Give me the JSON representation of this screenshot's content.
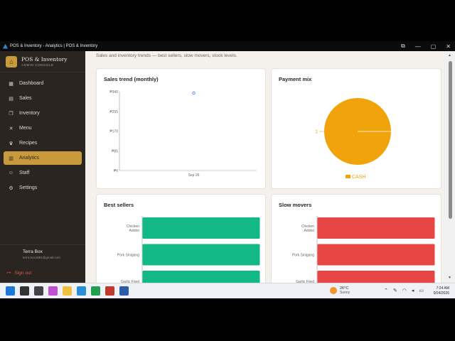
{
  "window": {
    "title": "POS & Inventory - Analytics | POS & Inventory",
    "minimize": "—",
    "maximize": "▢",
    "close": "✕",
    "extra": "⧉"
  },
  "brand": {
    "name": "POS & Inventory",
    "subtitle": "ADMIN CONSOLE"
  },
  "sidebar": {
    "items": [
      {
        "label": "Dashboard",
        "icon": "grid-icon",
        "glyph": "▦"
      },
      {
        "label": "Sales",
        "icon": "receipt-icon",
        "glyph": "▤"
      },
      {
        "label": "Inventory",
        "icon": "boxes-icon",
        "glyph": "❒"
      },
      {
        "label": "Menu",
        "icon": "utensils-icon",
        "glyph": "✕"
      },
      {
        "label": "Recipes",
        "icon": "chef-hat-icon",
        "glyph": "♛"
      },
      {
        "label": "Analytics",
        "icon": "bar-chart-icon",
        "glyph": "▥",
        "active": true
      },
      {
        "label": "Staff",
        "icon": "users-icon",
        "glyph": "☺"
      },
      {
        "label": "Settings",
        "icon": "gear-icon",
        "glyph": "⚙"
      }
    ]
  },
  "user": {
    "name": "Terra Box",
    "email": "terra.box1881@gmail.com"
  },
  "signout": {
    "label": "Sign out",
    "glyph": "↦"
  },
  "main": {
    "subtitle": "Sales and inventory trends — best sellers, slow movers, stock levels."
  },
  "cards": {
    "sales_trend": {
      "title": "Sales trend (monthly)"
    },
    "payment_mix": {
      "title": "Payment mix"
    },
    "best_sellers": {
      "title": "Best sellers"
    },
    "slow_movers": {
      "title": "Slow movers"
    }
  },
  "chart_data": [
    {
      "type": "line",
      "title": "Sales trend (monthly)",
      "x": [
        "Sep 26"
      ],
      "series": [
        {
          "values": [
            340
          ]
        }
      ],
      "yticks": [
        "₱340",
        "₱255",
        "₱170",
        "₱85",
        "₱0"
      ],
      "ylim": [
        0,
        340
      ],
      "color": "#3b7dd8"
    },
    {
      "type": "pie",
      "title": "Payment mix",
      "slices": [
        {
          "label": "CASH",
          "value": 1
        }
      ],
      "data_label": "1",
      "color": "#f0a30a"
    },
    {
      "type": "bar",
      "title": "Best sellers",
      "orientation": "horizontal",
      "categories": [
        [
          "Chicken",
          "Adobo"
        ],
        [
          "Pork Sinigang"
        ],
        [
          "Garlic Fried"
        ]
      ],
      "values": [
        1,
        1,
        1
      ],
      "color": "#12b886"
    },
    {
      "type": "bar",
      "title": "Slow movers",
      "orientation": "horizontal",
      "categories": [
        [
          "Chicken",
          "Adobo"
        ],
        [
          "Pork Sinigang"
        ],
        [
          "Garlic Fried"
        ]
      ],
      "values": [
        1,
        1,
        1
      ],
      "color": "#e84545"
    }
  ],
  "taskbar": {
    "weather": {
      "temp": "26°C",
      "condition": "Sunny"
    },
    "clock": {
      "time": "7:24 AM",
      "date": "9/24/2026"
    },
    "tray": {
      "up": "⌃",
      "pen": "✎",
      "wifi": "◠",
      "volume": "◂",
      "battery": "▭"
    },
    "apps": [
      {
        "name": "windows-start-icon",
        "color": "#1e78d7"
      },
      {
        "name": "search-icon",
        "color": "#333333"
      },
      {
        "name": "task-view-icon",
        "color": "#444444"
      },
      {
        "name": "copilot-icon",
        "color": "#c050d0"
      },
      {
        "name": "file-explorer-icon",
        "color": "#f0c040"
      },
      {
        "name": "edge-icon",
        "color": "#2a8fd8"
      },
      {
        "name": "sticky-app-icon",
        "color": "#1f9f4f"
      },
      {
        "name": "pos-app-icon",
        "color": "#c0392b"
      },
      {
        "name": "active-window-icon",
        "color": "#2c5ea8"
      }
    ]
  }
}
